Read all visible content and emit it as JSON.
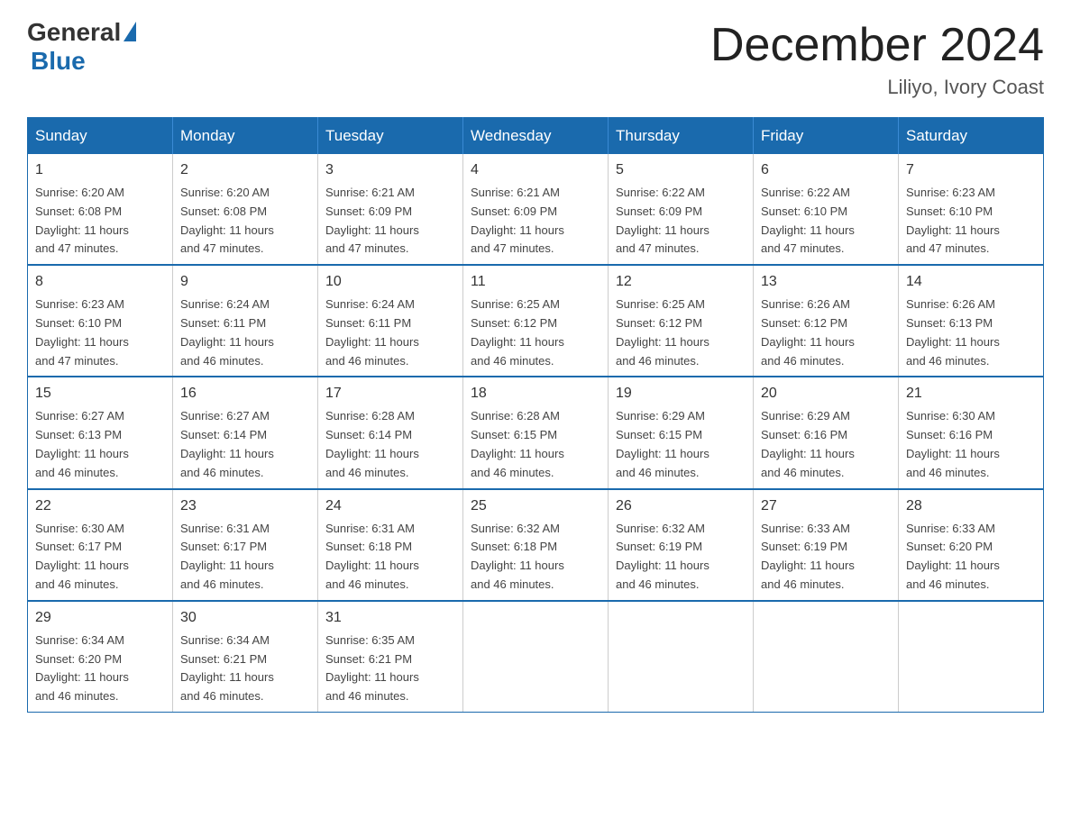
{
  "header": {
    "logo": {
      "general": "General",
      "blue": "Blue"
    },
    "title": "December 2024",
    "subtitle": "Liliyo, Ivory Coast"
  },
  "calendar": {
    "days": [
      "Sunday",
      "Monday",
      "Tuesday",
      "Wednesday",
      "Thursday",
      "Friday",
      "Saturday"
    ],
    "weeks": [
      [
        {
          "day": "1",
          "sunrise": "6:20 AM",
          "sunset": "6:08 PM",
          "daylight": "11 hours and 47 minutes."
        },
        {
          "day": "2",
          "sunrise": "6:20 AM",
          "sunset": "6:08 PM",
          "daylight": "11 hours and 47 minutes."
        },
        {
          "day": "3",
          "sunrise": "6:21 AM",
          "sunset": "6:09 PM",
          "daylight": "11 hours and 47 minutes."
        },
        {
          "day": "4",
          "sunrise": "6:21 AM",
          "sunset": "6:09 PM",
          "daylight": "11 hours and 47 minutes."
        },
        {
          "day": "5",
          "sunrise": "6:22 AM",
          "sunset": "6:09 PM",
          "daylight": "11 hours and 47 minutes."
        },
        {
          "day": "6",
          "sunrise": "6:22 AM",
          "sunset": "6:10 PM",
          "daylight": "11 hours and 47 minutes."
        },
        {
          "day": "7",
          "sunrise": "6:23 AM",
          "sunset": "6:10 PM",
          "daylight": "11 hours and 47 minutes."
        }
      ],
      [
        {
          "day": "8",
          "sunrise": "6:23 AM",
          "sunset": "6:10 PM",
          "daylight": "11 hours and 47 minutes."
        },
        {
          "day": "9",
          "sunrise": "6:24 AM",
          "sunset": "6:11 PM",
          "daylight": "11 hours and 46 minutes."
        },
        {
          "day": "10",
          "sunrise": "6:24 AM",
          "sunset": "6:11 PM",
          "daylight": "11 hours and 46 minutes."
        },
        {
          "day": "11",
          "sunrise": "6:25 AM",
          "sunset": "6:12 PM",
          "daylight": "11 hours and 46 minutes."
        },
        {
          "day": "12",
          "sunrise": "6:25 AM",
          "sunset": "6:12 PM",
          "daylight": "11 hours and 46 minutes."
        },
        {
          "day": "13",
          "sunrise": "6:26 AM",
          "sunset": "6:12 PM",
          "daylight": "11 hours and 46 minutes."
        },
        {
          "day": "14",
          "sunrise": "6:26 AM",
          "sunset": "6:13 PM",
          "daylight": "11 hours and 46 minutes."
        }
      ],
      [
        {
          "day": "15",
          "sunrise": "6:27 AM",
          "sunset": "6:13 PM",
          "daylight": "11 hours and 46 minutes."
        },
        {
          "day": "16",
          "sunrise": "6:27 AM",
          "sunset": "6:14 PM",
          "daylight": "11 hours and 46 minutes."
        },
        {
          "day": "17",
          "sunrise": "6:28 AM",
          "sunset": "6:14 PM",
          "daylight": "11 hours and 46 minutes."
        },
        {
          "day": "18",
          "sunrise": "6:28 AM",
          "sunset": "6:15 PM",
          "daylight": "11 hours and 46 minutes."
        },
        {
          "day": "19",
          "sunrise": "6:29 AM",
          "sunset": "6:15 PM",
          "daylight": "11 hours and 46 minutes."
        },
        {
          "day": "20",
          "sunrise": "6:29 AM",
          "sunset": "6:16 PM",
          "daylight": "11 hours and 46 minutes."
        },
        {
          "day": "21",
          "sunrise": "6:30 AM",
          "sunset": "6:16 PM",
          "daylight": "11 hours and 46 minutes."
        }
      ],
      [
        {
          "day": "22",
          "sunrise": "6:30 AM",
          "sunset": "6:17 PM",
          "daylight": "11 hours and 46 minutes."
        },
        {
          "day": "23",
          "sunrise": "6:31 AM",
          "sunset": "6:17 PM",
          "daylight": "11 hours and 46 minutes."
        },
        {
          "day": "24",
          "sunrise": "6:31 AM",
          "sunset": "6:18 PM",
          "daylight": "11 hours and 46 minutes."
        },
        {
          "day": "25",
          "sunrise": "6:32 AM",
          "sunset": "6:18 PM",
          "daylight": "11 hours and 46 minutes."
        },
        {
          "day": "26",
          "sunrise": "6:32 AM",
          "sunset": "6:19 PM",
          "daylight": "11 hours and 46 minutes."
        },
        {
          "day": "27",
          "sunrise": "6:33 AM",
          "sunset": "6:19 PM",
          "daylight": "11 hours and 46 minutes."
        },
        {
          "day": "28",
          "sunrise": "6:33 AM",
          "sunset": "6:20 PM",
          "daylight": "11 hours and 46 minutes."
        }
      ],
      [
        {
          "day": "29",
          "sunrise": "6:34 AM",
          "sunset": "6:20 PM",
          "daylight": "11 hours and 46 minutes."
        },
        {
          "day": "30",
          "sunrise": "6:34 AM",
          "sunset": "6:21 PM",
          "daylight": "11 hours and 46 minutes."
        },
        {
          "day": "31",
          "sunrise": "6:35 AM",
          "sunset": "6:21 PM",
          "daylight": "11 hours and 46 minutes."
        },
        null,
        null,
        null,
        null
      ]
    ],
    "labels": {
      "sunrise": "Sunrise:",
      "sunset": "Sunset:",
      "daylight": "Daylight:"
    }
  }
}
